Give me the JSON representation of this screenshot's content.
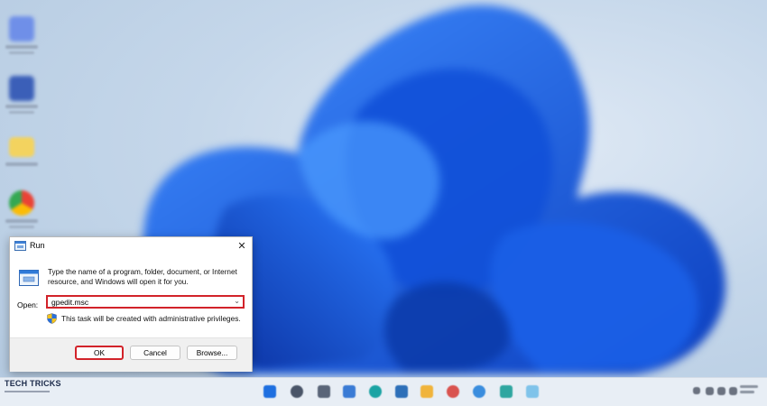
{
  "dialog": {
    "title": "Run",
    "description": "Type the name of a program, folder, document, or Internet resource, and Windows will open it for you.",
    "open_label": "Open:",
    "open_value": "gpedit.msc",
    "admin_note": "This task will be created with administrative privileges.",
    "buttons": {
      "ok": "OK",
      "cancel": "Cancel",
      "browse": "Browse..."
    },
    "close_glyph": "✕",
    "dropdown_glyph": "⌄",
    "icons": {
      "title": "run-icon",
      "body": "run-icon",
      "shield": "uac-shield-icon"
    }
  },
  "desktop_icons": [
    {
      "name": "app-shortcut-icon",
      "color": "#6f8fe8"
    },
    {
      "name": "facebook-icon",
      "color": "#3b5fb8"
    },
    {
      "name": "folder-icon",
      "color": "#f3d35f"
    },
    {
      "name": "google-chrome-icon",
      "color": "#34a853"
    }
  ],
  "taskbar": {
    "icons": [
      "start-icon",
      "search-icon",
      "task-view-icon",
      "widgets-icon",
      "edge-icon",
      "store-icon",
      "file-explorer-icon",
      "mail-icon",
      "chrome-icon",
      "app-icon",
      "settings-icon"
    ],
    "tray": [
      "chevron-up-icon",
      "network-icon",
      "volume-icon",
      "battery-icon"
    ]
  },
  "watermark": {
    "text": "TECH TRICKS"
  },
  "colors": {
    "highlight": "#d2232a",
    "accent": "#0a5fd6"
  }
}
